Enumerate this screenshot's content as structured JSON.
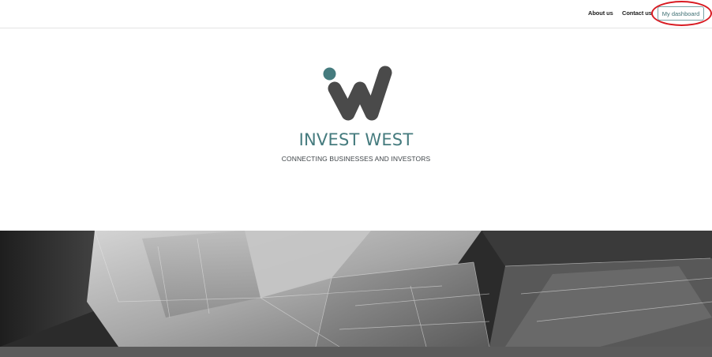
{
  "nav": {
    "about": "About us",
    "contact": "Contact us",
    "dashboard": "My dashboard"
  },
  "brand": {
    "name": "INVEST WEST",
    "tagline": "CONNECTING BUSINESSES AND INVESTORS",
    "logo_icon": "invest-west-w-logo",
    "accent_color": "#457b7e",
    "logo_dark_color": "#4a4a4a"
  },
  "annotation": {
    "color": "#d81b22"
  },
  "hero": {
    "image": "grayscale-architectural-glass-facade"
  }
}
